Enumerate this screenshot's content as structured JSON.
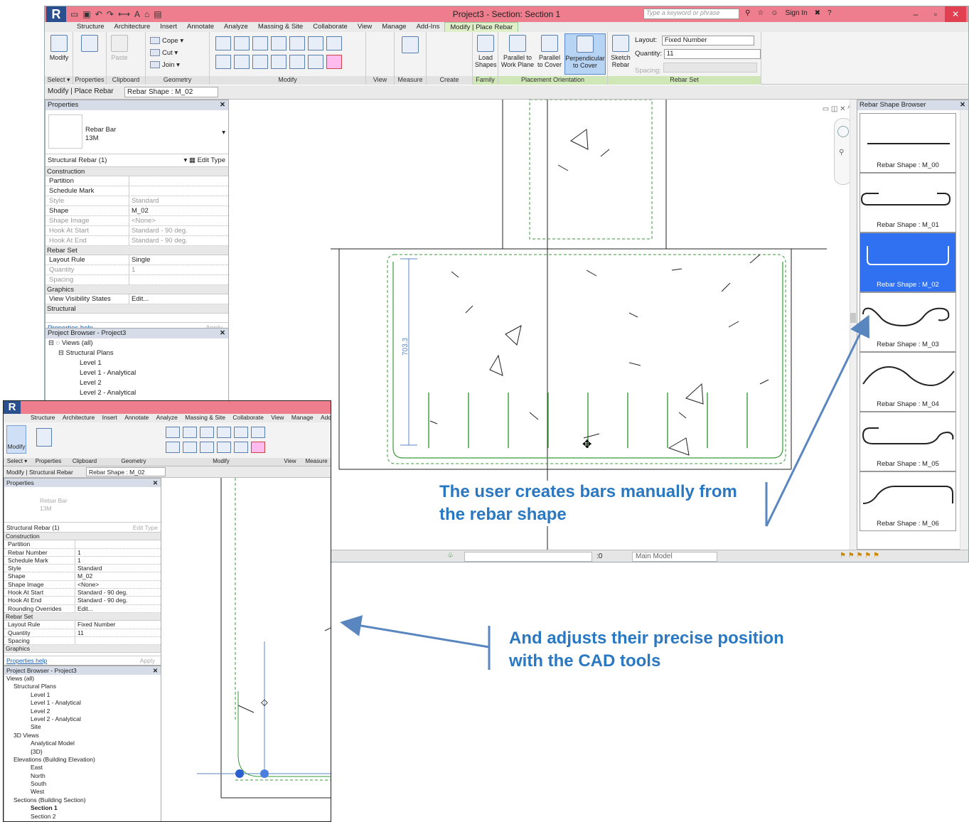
{
  "main_window": {
    "title": "Project3 - Section: Section 1",
    "search_placeholder": "Type a keyword or phrase",
    "sign_in": "Sign In",
    "tabs": [
      "Structure",
      "Architecture",
      "Insert",
      "Annotate",
      "Analyze",
      "Massing & Site",
      "Collaborate",
      "View",
      "Manage",
      "Add-Ins",
      "Modify | Place Rebar"
    ],
    "ribbon": {
      "select_label": "Select ▾",
      "modify_label": "Modify",
      "groups": [
        "Properties",
        "Clipboard",
        "Geometry",
        "Modify",
        "View",
        "Measure",
        "Create",
        "Family",
        "Placement Orientation",
        "Rebar Set"
      ],
      "paste_label": "Paste",
      "cope_label": "Cope",
      "cut_label": "Cut",
      "join_label": "Join",
      "load_shapes_label": "Load Shapes",
      "parallel_work_plane": "Parallel to Work Plane",
      "parallel_cover": "Parallel to Cover",
      "perpendicular_cover": "Perpendicular to Cover",
      "sketch_rebar": "Sketch Rebar",
      "layout_label": "Layout:",
      "layout_value": "Fixed Number",
      "quantity_label": "Quantity:",
      "quantity_value": "11",
      "spacing_label": "Spacing:"
    },
    "option_bar": {
      "context": "Modify | Place Rebar",
      "shape": "Rebar Shape : M_02"
    },
    "properties": {
      "header": "Properties",
      "type_name": "Rebar Bar",
      "type_size": "13M",
      "selector": "Structural Rebar (1)",
      "edit_type": "Edit Type",
      "rows": [
        {
          "cat": "Construction"
        },
        {
          "k": "Partition",
          "v": ""
        },
        {
          "k": "Schedule Mark",
          "v": ""
        },
        {
          "k": "Style",
          "v": "Standard",
          "grey": true
        },
        {
          "k": "Shape",
          "v": "M_02"
        },
        {
          "k": "Shape Image",
          "v": "<None>",
          "grey": true
        },
        {
          "k": "Hook At Start",
          "v": "Standard - 90 deg.",
          "grey": true
        },
        {
          "k": "Hook At End",
          "v": "Standard - 90 deg.",
          "grey": true
        },
        {
          "cat": "Rebar Set"
        },
        {
          "k": "Layout Rule",
          "v": "Single"
        },
        {
          "k": "Quantity",
          "v": "1",
          "grey": true
        },
        {
          "k": "Spacing",
          "v": "",
          "grey": true
        },
        {
          "cat": "Graphics"
        },
        {
          "k": "View Visibility States",
          "v": "Edit..."
        },
        {
          "cat": "Structural"
        }
      ],
      "help": "Properties help",
      "apply": "Apply"
    },
    "project_browser": {
      "header": "Project Browser - Project3",
      "items": [
        "Views (all)",
        "Structural Plans",
        "Level 1",
        "Level 1 - Analytical",
        "Level 2",
        "Level 2 - Analytical"
      ]
    },
    "dimension_text": "703.3",
    "status": {
      "model": "Main Model",
      "zero": ":0"
    },
    "shape_browser": {
      "header": "Rebar Shape Browser",
      "shapes": [
        "Rebar Shape : M_00",
        "Rebar Shape : M_01",
        "Rebar Shape : M_02",
        "Rebar Shape : M_03",
        "Rebar Shape : M_04",
        "Rebar Shape : M_05",
        "Rebar Shape : M_06"
      ],
      "selected": 2
    }
  },
  "inset_window": {
    "tabs": [
      "Structure",
      "Architecture",
      "Insert",
      "Annotate",
      "Analyze",
      "Massing & Site",
      "Collaborate",
      "View",
      "Manage",
      "Add-I"
    ],
    "groups": [
      "Select ▾",
      "Properties",
      "Clipboard",
      "Geometry",
      "Modify",
      "View",
      "Measure"
    ],
    "modify_label": "Modify",
    "option_bar": {
      "context": "Modify | Structural Rebar",
      "shape": "Rebar Shape : M_02"
    },
    "properties": {
      "header": "Properties",
      "type_name": "Rebar Bar",
      "type_size": "13M",
      "selector": "Structural Rebar (1)",
      "edit_type": "Edit Type",
      "rows": [
        {
          "cat": "Construction"
        },
        {
          "k": "Partition",
          "v": ""
        },
        {
          "k": "Rebar Number",
          "v": "1"
        },
        {
          "k": "Schedule Mark",
          "v": "1"
        },
        {
          "k": "Style",
          "v": "Standard"
        },
        {
          "k": "Shape",
          "v": "M_02"
        },
        {
          "k": "Shape Image",
          "v": "<None>"
        },
        {
          "k": "Hook At Start",
          "v": "Standard - 90 deg."
        },
        {
          "k": "Hook At End",
          "v": "Standard - 90 deg."
        },
        {
          "k": "Rounding Overrides",
          "v": "Edit..."
        },
        {
          "cat": "Rebar Set"
        },
        {
          "k": "Layout Rule",
          "v": "Fixed Number"
        },
        {
          "k": "Quantity",
          "v": "11"
        },
        {
          "k": "Spacing",
          "v": ""
        },
        {
          "cat": "Graphics"
        }
      ],
      "help": "Properties help",
      "apply": "Apply"
    },
    "project_browser": {
      "header": "Project Browser - Project3",
      "items": [
        "Views (all)",
        "Structural Plans",
        "Level 1",
        "Level 1 - Analytical",
        "Level 2",
        "Level 2 - Analytical",
        "Site",
        "3D Views",
        "Analytical Model",
        "{3D}",
        "Elevations (Building Elevation)",
        "East",
        "North",
        "South",
        "West",
        "Sections (Building Section)",
        "Section 1",
        "Section 2"
      ]
    }
  },
  "annotations": {
    "first": "The user creates bars manually from the rebar shape",
    "second": "And adjusts their precise position with the CAD tools"
  },
  "colors": {
    "title_bar": "#ee7e8d",
    "selection": "#2f71f0",
    "annotation": "#2b78c2",
    "rebar": "#3a9a3a"
  }
}
